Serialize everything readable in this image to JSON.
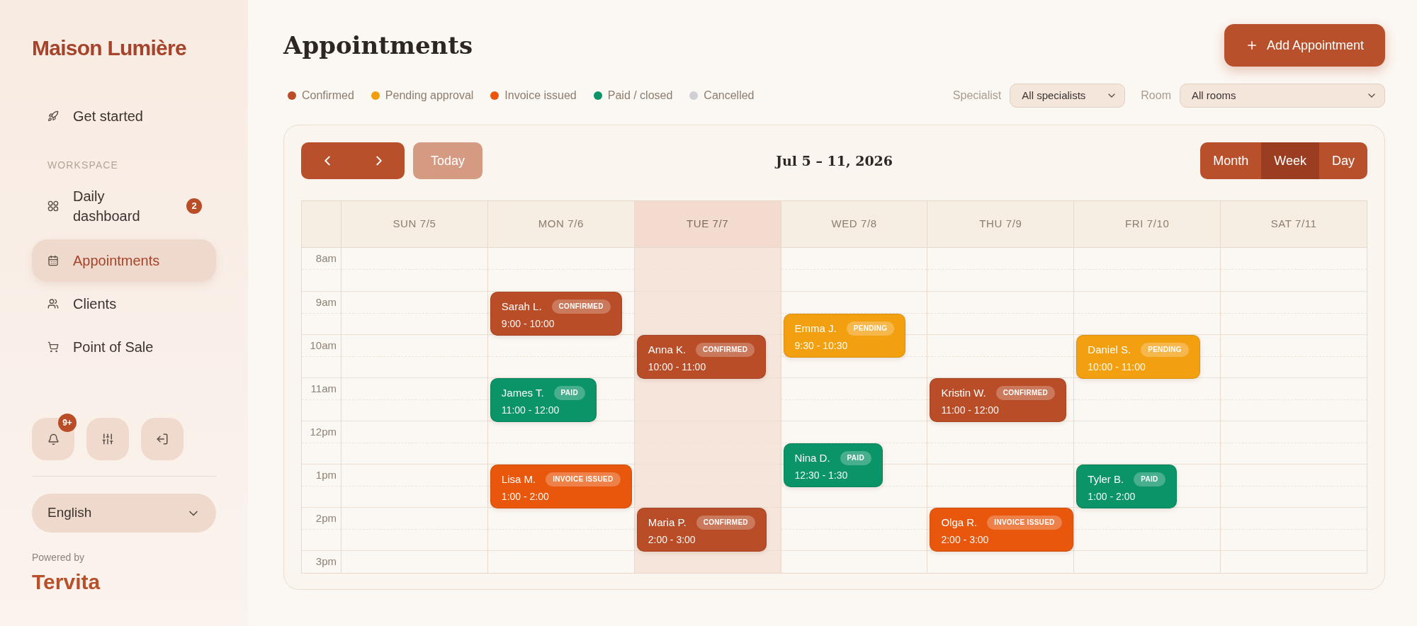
{
  "sidebar": {
    "brand": "Maison Lumière",
    "nav": [
      {
        "label": "Get started",
        "selected": false
      }
    ],
    "section": {
      "title": "WORKSPACE",
      "items": [
        {
          "label": "Daily dashboard",
          "badge": "2",
          "selected": false
        },
        {
          "label": "Appointments",
          "selected": true
        },
        {
          "label": "Clients",
          "selected": false
        },
        {
          "label": "Point of Sale",
          "selected": false
        }
      ]
    },
    "notification_badge": "9+",
    "language": "English",
    "powered_by": "Powered by",
    "vendor": "Tervita"
  },
  "header": {
    "title": "Appointments",
    "add_button": "Add Appointment"
  },
  "legend": [
    {
      "label": "Confirmed",
      "color": "#b84d27"
    },
    {
      "label": "Pending approval",
      "color": "#f29e0c"
    },
    {
      "label": "Invoice issued",
      "color": "#e8570c"
    },
    {
      "label": "Paid / closed",
      "color": "#0b9468"
    },
    {
      "label": "Cancelled",
      "color": "#cfd0d6"
    }
  ],
  "filters": [
    {
      "label": "Specialist",
      "value": "All specialists"
    },
    {
      "label": "Room",
      "value": "All rooms"
    }
  ],
  "calendar": {
    "today_button": {
      "label": "Today",
      "disabled": true
    },
    "range": "Jul 5 – 11, 2026",
    "views": [
      {
        "label": "Month",
        "selected": false
      },
      {
        "label": "Week",
        "selected": true
      },
      {
        "label": "Day",
        "selected": false
      }
    ],
    "hours": [
      "8am",
      "9am",
      "10am",
      "11am",
      "12pm",
      "1pm",
      "2pm",
      "3pm"
    ],
    "days": [
      {
        "label": "SUN 7/5",
        "today": false
      },
      {
        "label": "MON 7/6",
        "today": false,
        "events": [
          {
            "name": "Sarah L.",
            "status": "CONFIRMED",
            "time": "9:00 - 10:00",
            "color": "#b84d27"
          },
          {
            "name": "James T.",
            "status": "PAID",
            "time": "11:00 - 12:00",
            "color": "#0a9467"
          },
          {
            "name": "Lisa M.",
            "status": "INVOICE ISSUED",
            "time": "1:00 - 2:00",
            "color": "#e8570c"
          }
        ]
      },
      {
        "label": "TUE 7/7",
        "today": true,
        "events": [
          {
            "name": "Anna K.",
            "status": "CONFIRMED",
            "time": "10:00 - 11:00",
            "color": "#b84d27"
          },
          {
            "name": "Maria P.",
            "status": "CONFIRMED",
            "time": "2:00 - 3:00",
            "color": "#b84d27"
          }
        ]
      },
      {
        "label": "WED 7/8",
        "today": false,
        "events": [
          {
            "name": "Emma J.",
            "status": "PENDING",
            "time": "9:30 - 10:30",
            "color": "#f3a010"
          },
          {
            "name": "Nina D.",
            "status": "PAID",
            "time": "12:30 - 1:30",
            "color": "#0a9467"
          }
        ]
      },
      {
        "label": "THU 7/9",
        "today": false,
        "events": [
          {
            "name": "Kristin W.",
            "status": "CONFIRMED",
            "time": "11:00 - 12:00",
            "color": "#b84d27"
          },
          {
            "name": "Olga R.",
            "status": "INVOICE ISSUED",
            "time": "2:00 - 3:00",
            "color": "#e8570c"
          }
        ]
      },
      {
        "label": "FRI 7/10",
        "today": false,
        "events": [
          {
            "name": "Daniel S.",
            "status": "PENDING",
            "time": "10:00 - 11:00",
            "color": "#f3a010"
          },
          {
            "name": "Tyler B.",
            "status": "PAID",
            "time": "1:00 - 2:00",
            "color": "#0a9467"
          }
        ]
      },
      {
        "label": "SAT 7/11",
        "today": false
      }
    ]
  }
}
